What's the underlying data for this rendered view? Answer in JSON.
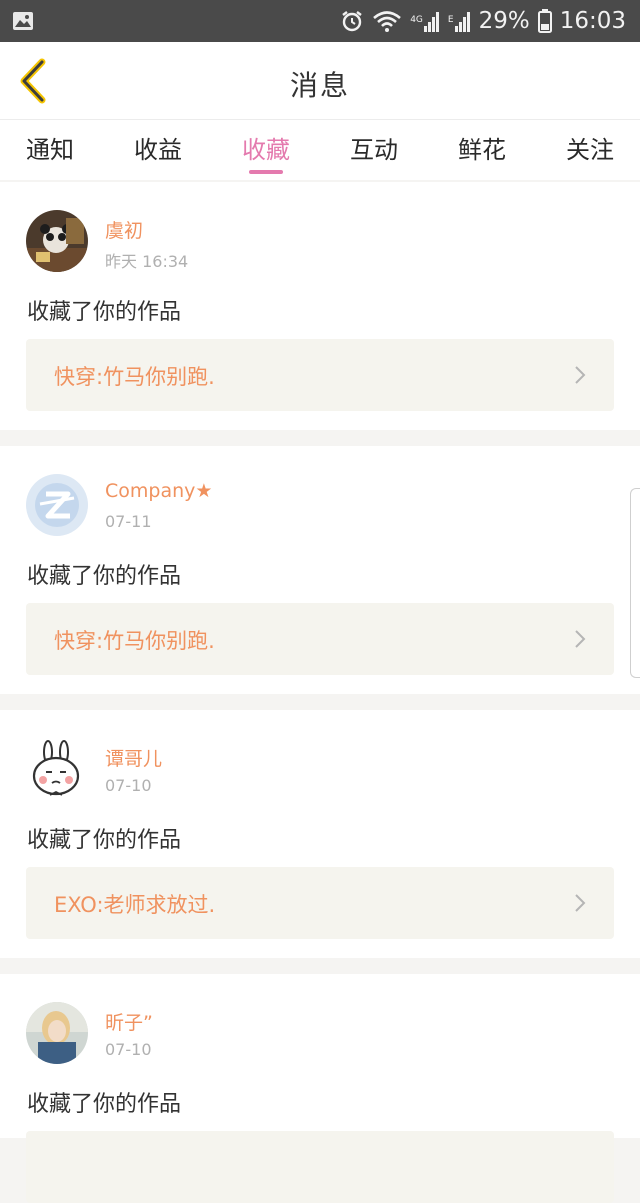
{
  "status_bar": {
    "battery": "29%",
    "time": "16:03",
    "net_labels": [
      "4G",
      "E"
    ]
  },
  "header": {
    "title": "消息"
  },
  "tabs": [
    {
      "label": "通知"
    },
    {
      "label": "收益"
    },
    {
      "label": "收藏"
    },
    {
      "label": "互动"
    },
    {
      "label": "鲜花"
    },
    {
      "label": "关注"
    }
  ],
  "active_tab": "收藏",
  "colors": {
    "accent": "#e47aae",
    "name": "#f0925f",
    "work_bg": "#f5f4ee"
  },
  "messages": [
    {
      "user": "虞初",
      "time": "昨天 16:34",
      "action": "收藏了你的作品",
      "work": "快穿:竹马你别跑.",
      "avatar": "photo-avatar-dark"
    },
    {
      "user": "Company★",
      "time": "07-11",
      "action": "收藏了你的作品",
      "work": "快穿:竹马你别跑.",
      "avatar": "qzone-default-avatar"
    },
    {
      "user": "谭哥儿",
      "time": "07-10",
      "action": "收藏了你的作品",
      "work": "EXO:老师求放过.",
      "avatar": "bunny-cartoon-avatar"
    },
    {
      "user": "昕子”",
      "time": "07-10",
      "action": "收藏了你的作品",
      "work": "",
      "avatar": "photo-avatar-girl"
    }
  ]
}
